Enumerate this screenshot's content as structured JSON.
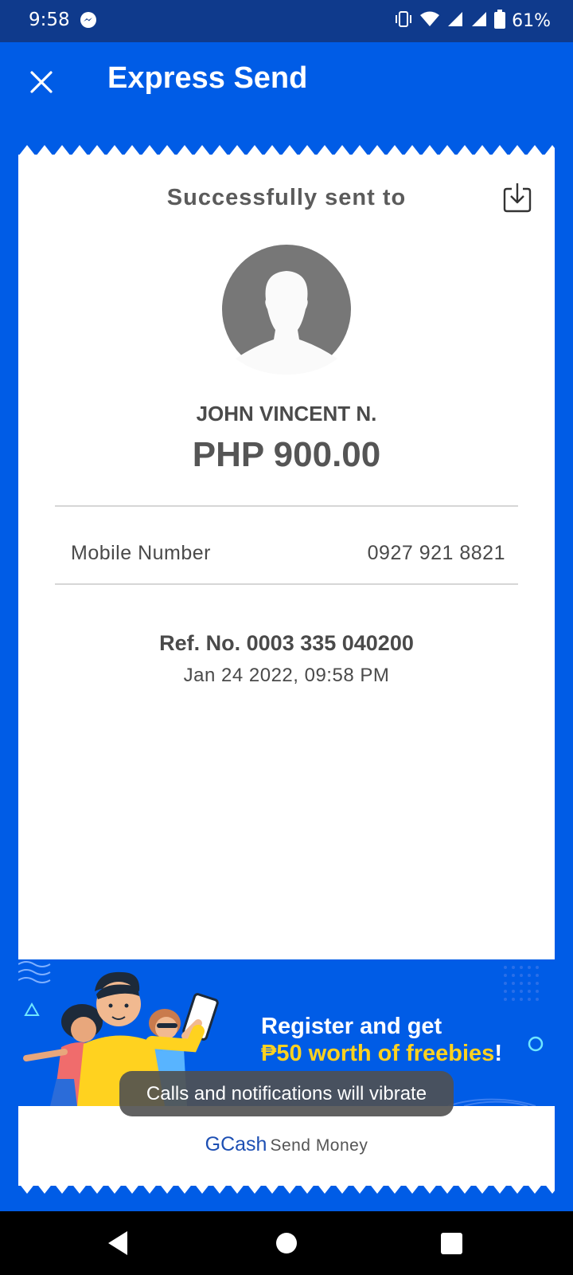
{
  "status_bar": {
    "time": "9:58",
    "battery": "61%",
    "icons": [
      "messenger-icon",
      "vibrate-icon",
      "wifi-icon",
      "signal-icon",
      "signal-icon",
      "battery-icon"
    ]
  },
  "header": {
    "title": "Express Send",
    "close_icon": "close-icon"
  },
  "receipt": {
    "success_text": "Successfully sent to",
    "recipient_name": "JOHN VINCENT N.",
    "amount": "PHP 900.00",
    "mobile_label": "Mobile Number",
    "mobile_value": "0927 921 8821",
    "ref_no": "Ref. No. 0003 335 040200",
    "date": "Jan 24 2022, 09:58 PM"
  },
  "banner": {
    "line1": "Register and get",
    "line2": "₱50 worth of freebies",
    "line2_end": "!"
  },
  "footer": {
    "brand": "GCash",
    "label": "Send Money"
  },
  "toast": {
    "text": "Calls and notifications will vibrate"
  },
  "colors": {
    "primary_blue": "#005ce6",
    "status_bar": "#0f3a8c",
    "highlight_yellow": "#ffd21f"
  }
}
